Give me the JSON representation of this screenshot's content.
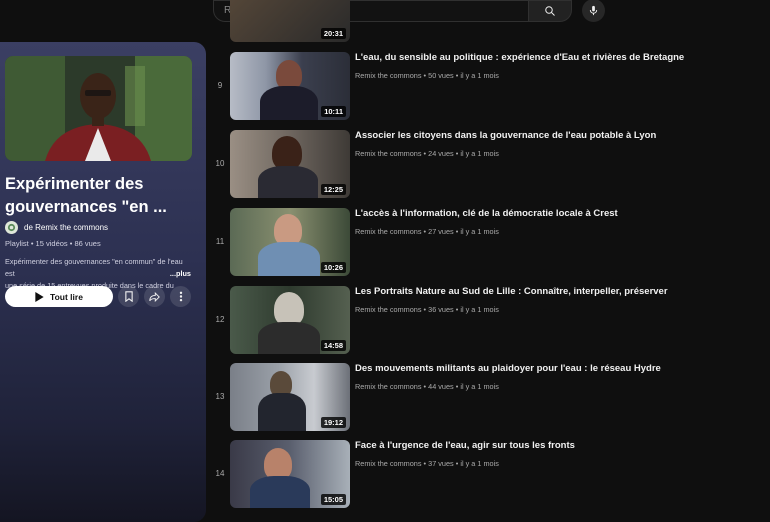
{
  "search": {
    "placeholder": "Rechercher"
  },
  "playlist": {
    "title": "Expérimenter des gouvernances \"en ...",
    "owner": "de Remix the commons",
    "meta": "Playlist • 15 vidéos • 86 vues",
    "description_line1": "Expérimenter des gouvernances \"en commun\" de l'eau est",
    "description_line2": "une série de 15 entrevues produite dans le cadre du",
    "more": "...plus",
    "play_all": "Tout lire"
  },
  "top_partial": {
    "duration": "20:31"
  },
  "videos": [
    {
      "index": "9",
      "title": "L'eau, du sensible au politique : expérience d'Eau et rivières de Bretagne",
      "channel": "Remix the commons",
      "views": "50 vues",
      "age": "il y a 1 mois",
      "duration": "10:11"
    },
    {
      "index": "10",
      "title": "Associer les citoyens dans la gouvernance de l'eau potable à Lyon",
      "channel": "Remix the commons",
      "views": "24 vues",
      "age": "il y a 1 mois",
      "duration": "12:25"
    },
    {
      "index": "11",
      "title": "L'accès à l'information, clé de la démocratie locale à Crest",
      "channel": "Remix the commons",
      "views": "27 vues",
      "age": "il y a 1 mois",
      "duration": "10:26"
    },
    {
      "index": "12",
      "title": "Les Portraits Nature au Sud de Lille : Connaître, interpeller, préserver",
      "channel": "Remix the commons",
      "views": "36 vues",
      "age": "il y a 1 mois",
      "duration": "14:58"
    },
    {
      "index": "13",
      "title": "Des mouvements militants au plaidoyer pour l'eau : le réseau Hydre",
      "channel": "Remix the commons",
      "views": "44 vues",
      "age": "il y a 1 mois",
      "duration": "19:12"
    },
    {
      "index": "14",
      "title": "Face à l'urgence de l'eau, agir sur tous les fronts",
      "channel": "Remix the commons",
      "views": "37 vues",
      "age": "il y a 1 mois",
      "duration": "15:05"
    }
  ],
  "separator": "•"
}
